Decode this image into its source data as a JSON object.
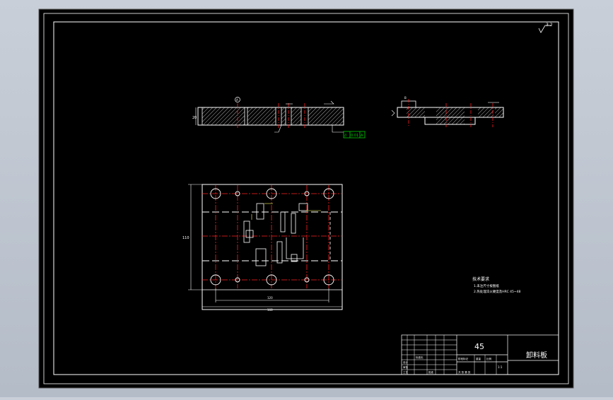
{
  "drawing": {
    "title": "卸料板",
    "material": "45",
    "roughness_mark": "3.2",
    "scale": "1:1",
    "geo_tolerance_box": {
      "symbol": "//",
      "value": "0.01",
      "datum": "A"
    },
    "section_labels": {
      "a": "A",
      "b": "B"
    },
    "dim_left_height": "20",
    "dim_plan_width": "160",
    "dim_plan_hole_spacing": "120",
    "dim_plan_height": "110"
  },
  "tech_requirements": {
    "title": "技术要求",
    "lines": [
      "1.未注尺寸按图纸",
      "2.热处理淬火硬度及HRC 45~48"
    ]
  },
  "title_block": {
    "designer_label": "设计",
    "checker_label": "审核",
    "standard_label": "标准化",
    "process_label": "工艺",
    "approve_label": "批准",
    "stage_label": "阶段标记",
    "weight_label": "重量",
    "scale_label": "比例",
    "sheet_label": "共 张 第 张"
  },
  "colors": {
    "frame_bg": "#000000",
    "line_white": "#ffffff",
    "center_red": "#ff2020",
    "hidden_yellow": "#ffff66",
    "tolerance_green": "#00d000"
  }
}
